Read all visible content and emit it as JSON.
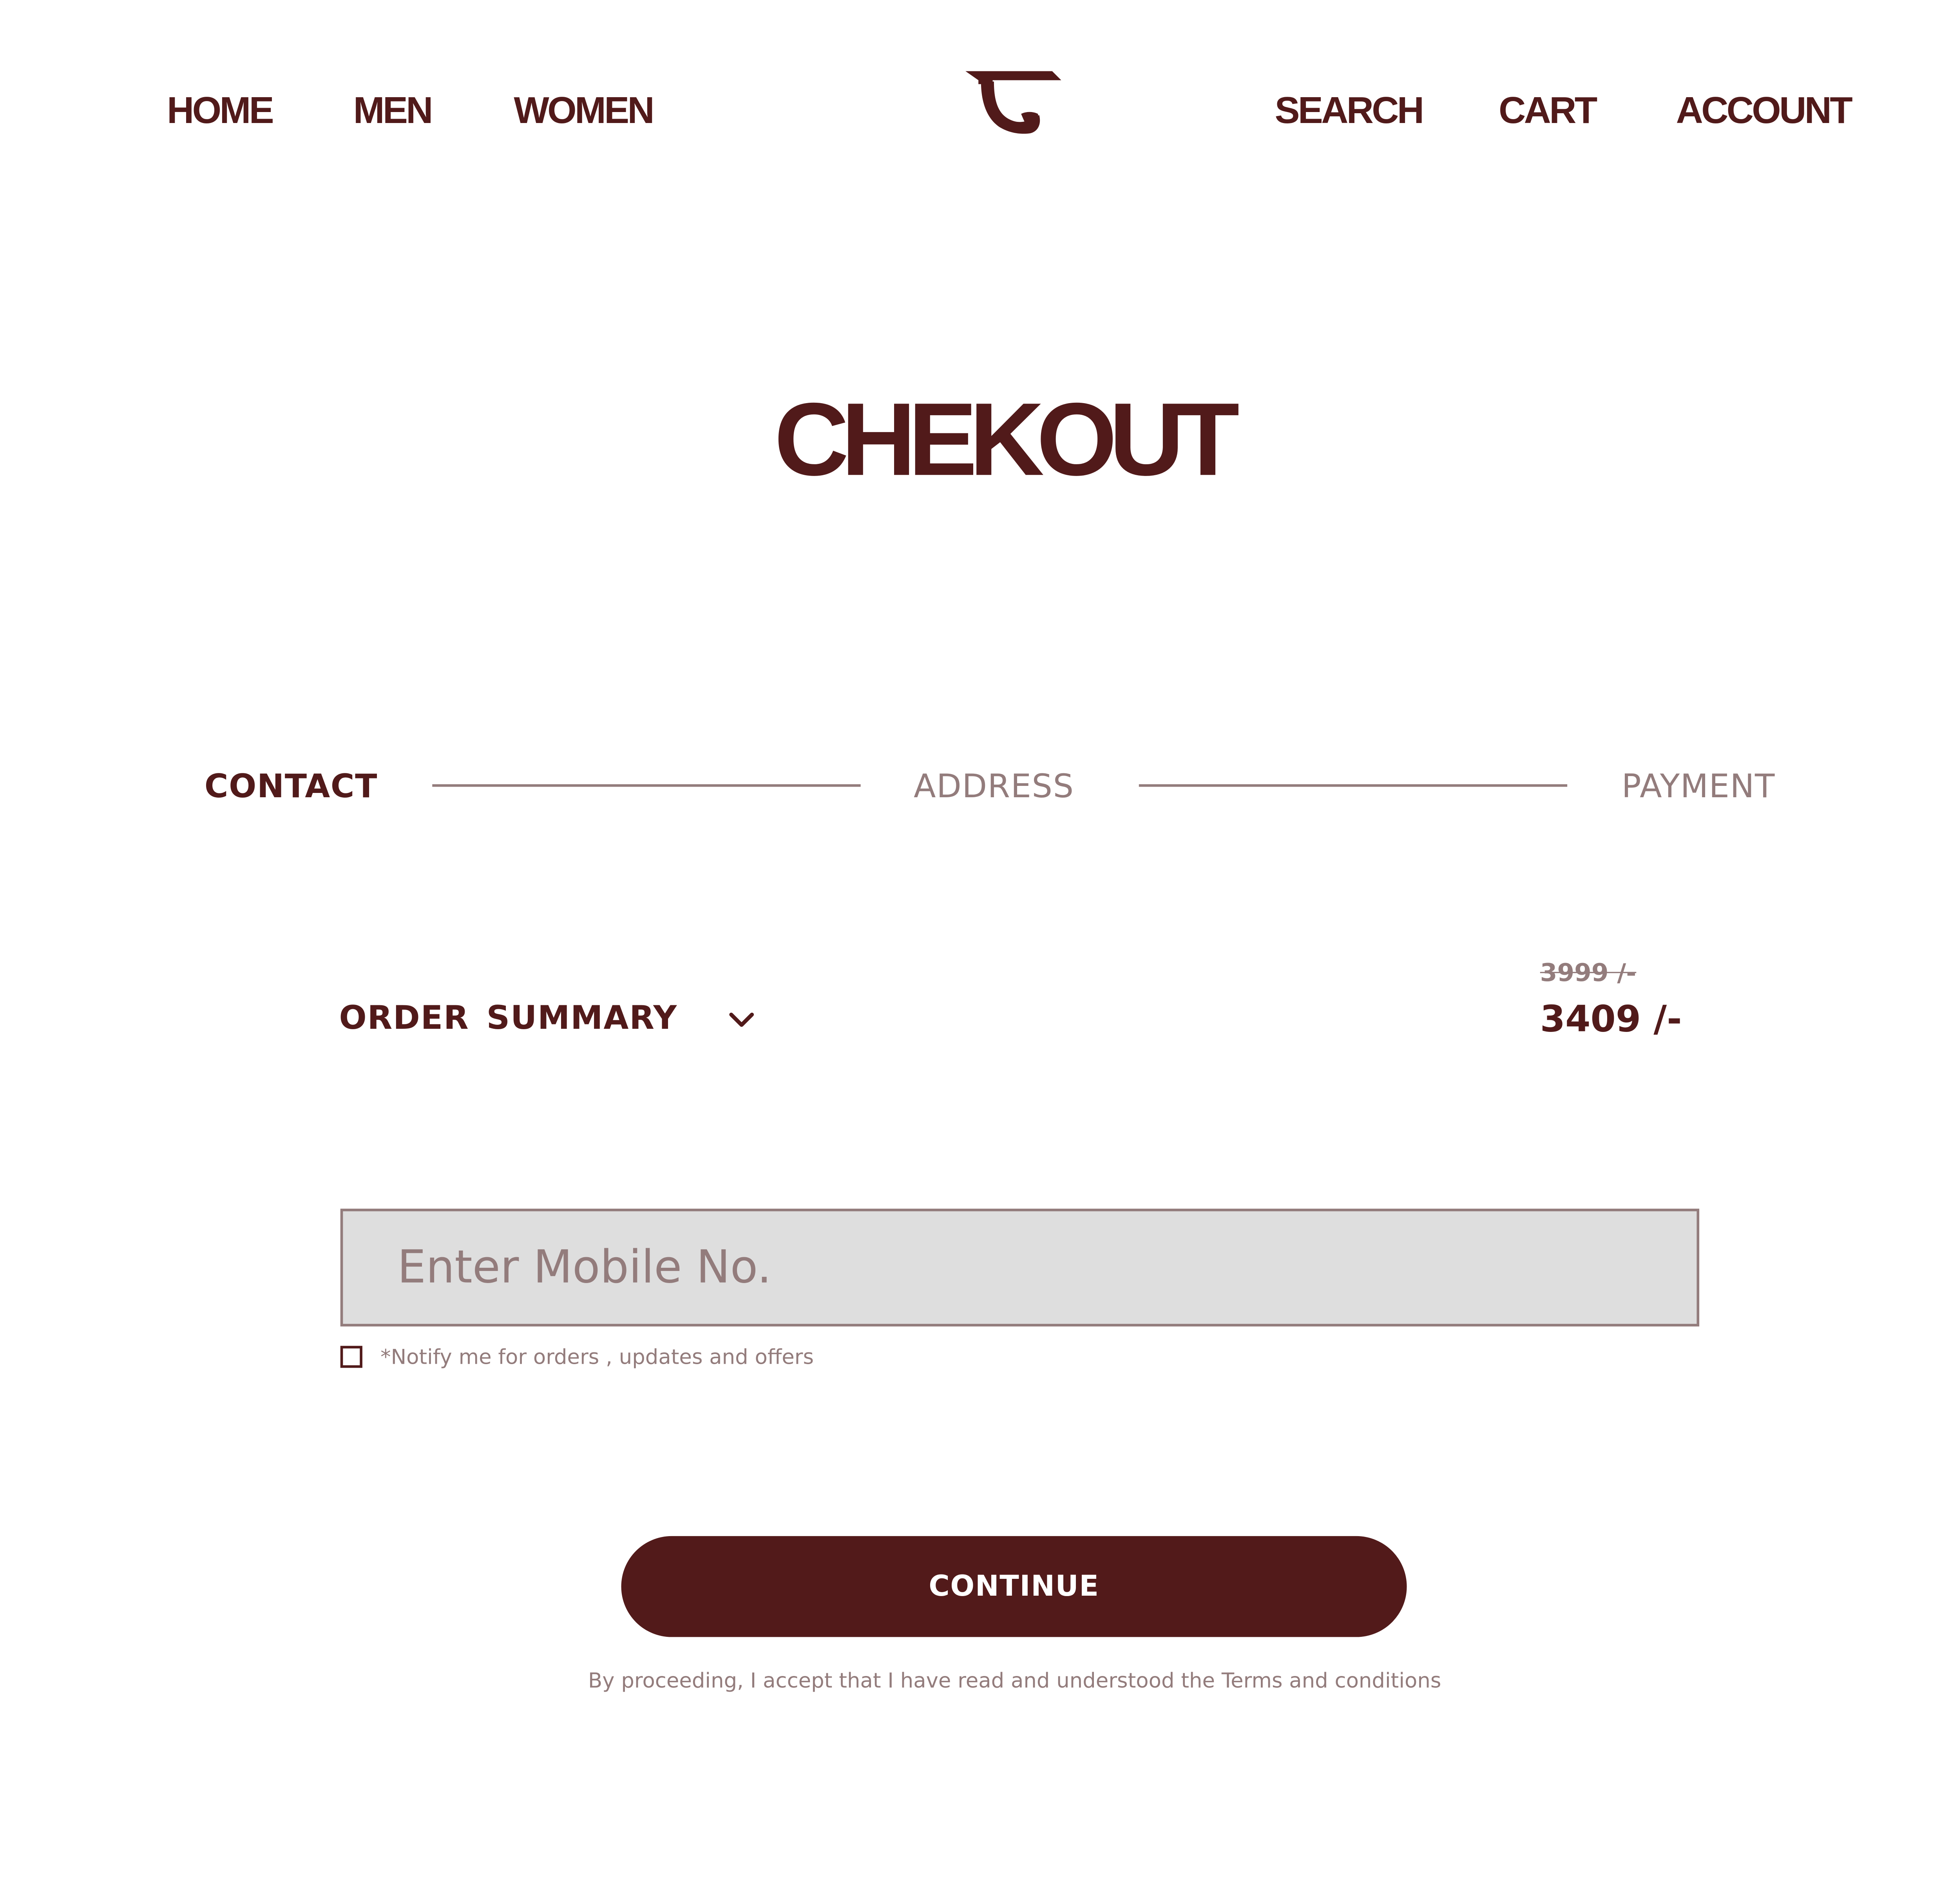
{
  "colors": {
    "brand": "#511a1a",
    "muted": "#937c7c",
    "input_bg": "#dedede",
    "background": "#ffffff"
  },
  "nav": {
    "left": [
      "HOME",
      "MEN",
      "WOMEN"
    ],
    "right": [
      "SEARCH",
      "CART",
      "ACCOUNT"
    ],
    "logo_icon": "brand-logo-icon"
  },
  "page": {
    "title": "CHEKOUT"
  },
  "stepper": {
    "steps": [
      {
        "label": "CONTACT",
        "active": true
      },
      {
        "label": "ADDRESS",
        "active": false
      },
      {
        "label": "PAYMENT",
        "active": false
      }
    ]
  },
  "order_summary": {
    "label": "ORDER  SUMMARY",
    "toggle_icon": "chevron-down-icon",
    "original_price": "3999 /-",
    "final_price": "3409 /-"
  },
  "contact_form": {
    "mobile_placeholder": "Enter Mobile No.",
    "mobile_value": "",
    "notify_checked": false,
    "notify_label": "*Notify me for orders , updates and offers"
  },
  "actions": {
    "continue_label": "CONTINUE",
    "terms_text": "By proceeding, I accept that I have read and understood the Terms and conditions"
  }
}
